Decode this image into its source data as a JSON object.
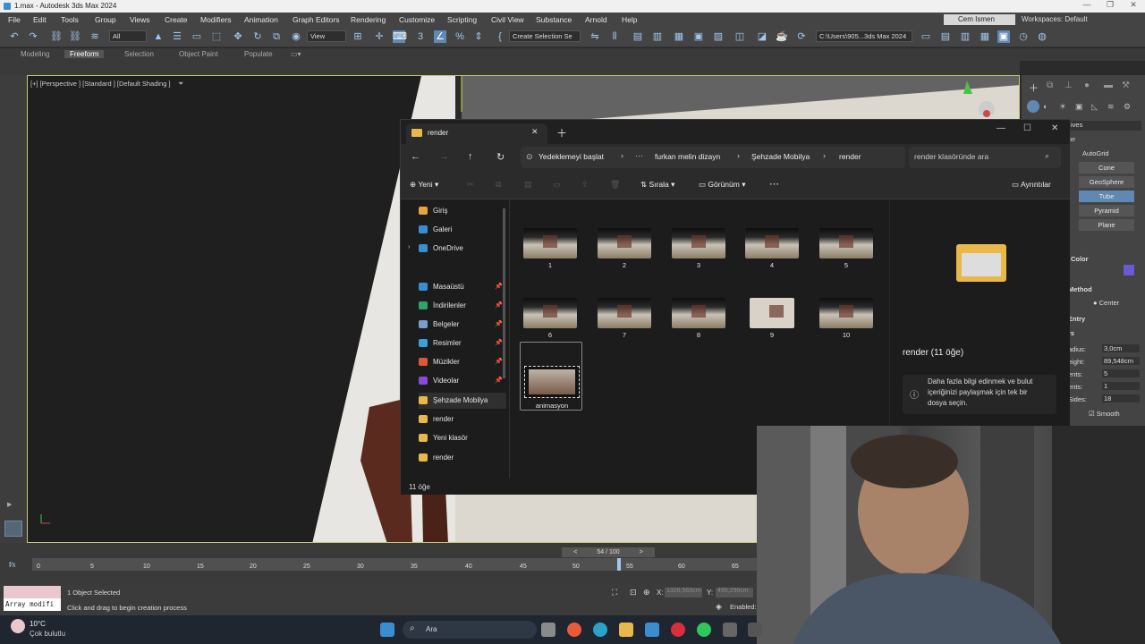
{
  "window": {
    "title": "1.max - Autodesk 3ds Max 2024"
  },
  "menu": [
    "File",
    "Edit",
    "Tools",
    "Group",
    "Views",
    "Create",
    "Modifiers",
    "Animation",
    "Graph Editors",
    "Rendering",
    "Customize",
    "Scripting",
    "Civil View",
    "Substance",
    "Arnold",
    "Help"
  ],
  "account": {
    "user": "Cem Ismen",
    "workspace": "Workspaces: Default"
  },
  "toolbar": {
    "filter": "All",
    "view": "View",
    "selection_set": "Create Selection Se",
    "path": "C:\\Users\\905...3ds Max 2024"
  },
  "ribbon": {
    "tabs": [
      "Modeling",
      "Freeform",
      "Selection",
      "Object Paint",
      "Populate"
    ],
    "active": "Freeform"
  },
  "viewport": {
    "label": "[+] [Perspective ] [Standard ] [Default Shading ]"
  },
  "command_panel": {
    "dropdown": "ives",
    "section_type": "pe",
    "autogrid": "AutoGrid",
    "buttons": [
      "Cone",
      "GeoSphere",
      "Tube",
      "Pyramid",
      "Plane"
    ],
    "color_label": "Color",
    "method_label": "Method",
    "center": "Center",
    "entry_label": "Entry",
    "params": [
      {
        "label": "adius:",
        "value": "3,0cm"
      },
      {
        "label": "eight:",
        "value": "89,548cm"
      },
      {
        "label": "ents:",
        "value": "5"
      },
      {
        "label": "ents:",
        "value": "1"
      },
      {
        "label": "Sides:",
        "value": "18"
      }
    ],
    "params_header": "rs",
    "smooth": "Smooth"
  },
  "explorer": {
    "tab_title": "render",
    "breadcrumb": [
      "Yedeklemeyi başlat",
      "furkan melin dizayn",
      "Şehzade Mobilya",
      "render"
    ],
    "search_placeholder": "render klasöründe ara",
    "cmd": {
      "new": "Yeni",
      "sort": "Sırala",
      "view": "Görünüm",
      "details": "Ayrıntılar"
    },
    "nav": [
      {
        "label": "Giriş",
        "color": "#e8a33d",
        "pin": ""
      },
      {
        "label": "Galeri",
        "color": "#3a8ed0",
        "pin": ""
      },
      {
        "label": "OneDrive",
        "color": "#3a8ed0",
        "pin": ""
      },
      {
        "label": "Masaüstü",
        "color": "#3a8ed0",
        "pin": "📌"
      },
      {
        "label": "İndirilenler",
        "color": "#2ea36b",
        "pin": "📌"
      },
      {
        "label": "Belgeler",
        "color": "#7a9ccf",
        "pin": "📌"
      },
      {
        "label": "Resimler",
        "color": "#3aa0d8",
        "pin": "📌"
      },
      {
        "label": "Müzikler",
        "color": "#d85a3a",
        "pin": "📌"
      },
      {
        "label": "Videolar",
        "color": "#8a4ad8",
        "pin": "📌"
      },
      {
        "label": "Şehzade Mobilya",
        "color": "#e8b84a",
        "pin": ""
      },
      {
        "label": "render",
        "color": "#e8b84a",
        "pin": ""
      },
      {
        "label": "Yeni klasör",
        "color": "#e8b84a",
        "pin": ""
      },
      {
        "label": "render",
        "color": "#e8b84a",
        "pin": ""
      }
    ],
    "files": [
      "1",
      "2",
      "3",
      "4",
      "5",
      "6",
      "7",
      "8",
      "9",
      "10",
      "animasyon"
    ],
    "details_title": "render (11 öğe)",
    "details_info": "Daha fazla bilgi edinmek ve bulut içeriğinizi paylaşmak için tek bir dosya seçin.",
    "status": "11 öğe"
  },
  "timeline": {
    "frame": "54 / 100",
    "ticks": [
      "0",
      "5",
      "10",
      "15",
      "20",
      "25",
      "30",
      "35",
      "40",
      "45",
      "50",
      "55",
      "60",
      "65"
    ],
    "current": 54,
    "total": 100
  },
  "status": {
    "selected": "1 Object Selected",
    "hint": "Click and drag to begin creation process",
    "script": "Array modifi",
    "x_label": "X:",
    "x_value": "1328,563cm",
    "y_label": "Y:",
    "y_value": "495,296cm",
    "enabled": "Enabled:"
  },
  "weather": {
    "temp": "10°C",
    "desc": "Çok bulutlu"
  },
  "taskbar": {
    "search": "Ara"
  }
}
